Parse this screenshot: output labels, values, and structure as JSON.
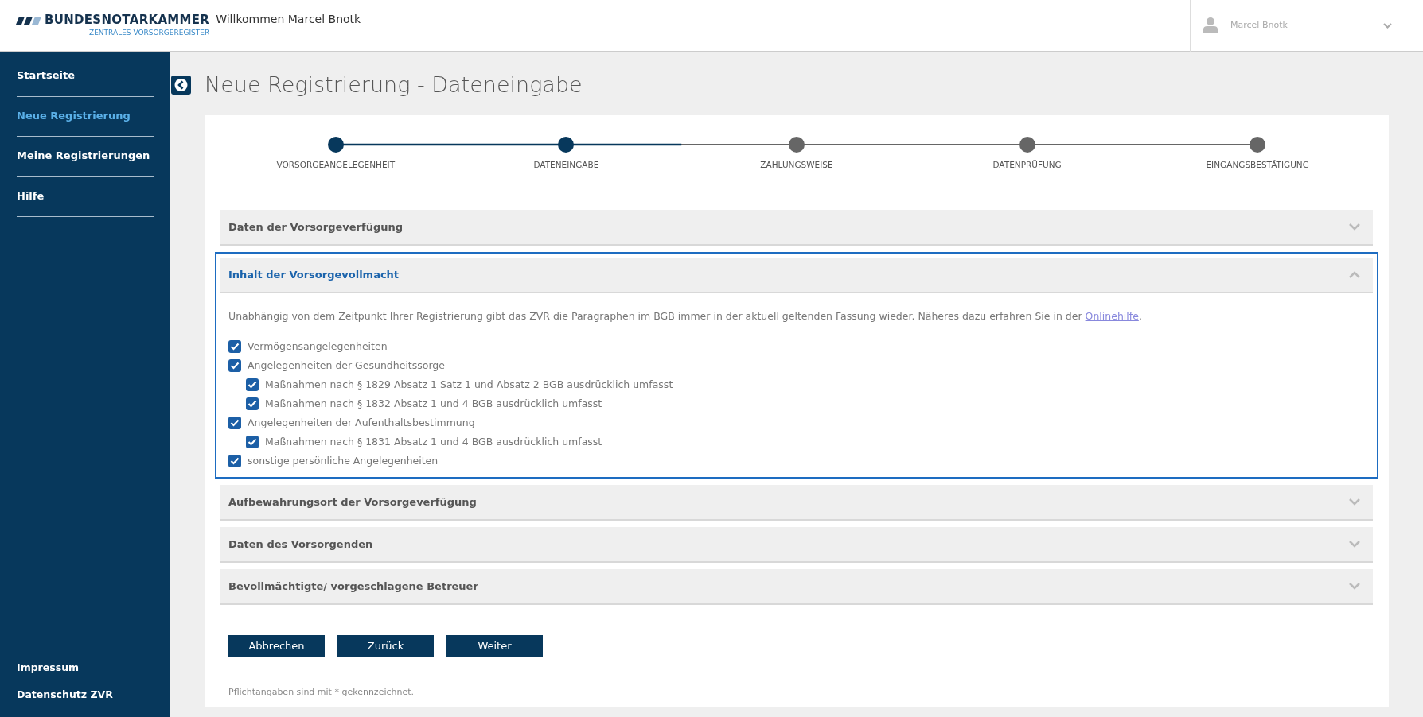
{
  "header": {
    "logo_title": "BUNDESNOTARKAMMER",
    "logo_subtitle": "ZENTRALES VORSORGEREGISTER",
    "welcome": "Willkommen Marcel Bnotk",
    "user_name": "Marcel Bnotk"
  },
  "sidebar": {
    "items": [
      {
        "label": "Startseite",
        "selected": false
      },
      {
        "label": "Neue Registrierung",
        "selected": true
      },
      {
        "label": "Meine Registrierungen",
        "selected": false
      },
      {
        "label": "Hilfe",
        "selected": false
      }
    ],
    "footer_links": [
      "Impressum",
      "Datenschutz ZVR"
    ]
  },
  "page_title": "Neue Registrierung - Dateneingabe",
  "steps": [
    {
      "label": "VORSORGEANGELEGENHEIT",
      "completed": true
    },
    {
      "label": "DATENEINGABE",
      "completed": true
    },
    {
      "label": "ZAHLUNGSWEISE",
      "completed": false
    },
    {
      "label": "DATENPRÜFUNG",
      "completed": false
    },
    {
      "label": "EINGANGSBESTÄTIGUNG",
      "completed": false
    }
  ],
  "sections": [
    {
      "title": "Daten der Vorsorgeverfügung",
      "expanded": false
    },
    {
      "title": "Inhalt der Vorsorgevollmacht",
      "expanded": true,
      "intro": {
        "text": "Unabhängig von dem Zeitpunkt Ihrer Registrierung gibt das ZVR die Paragraphen im BGB immer in der aktuell geltenden Fassung wieder. Näheres dazu erfahren Sie in der ",
        "link": "Onlinehilfe",
        "end": "."
      },
      "options": [
        {
          "label": "Vermögensangelegenheiten",
          "checked": true
        },
        {
          "label": "Angelegenheiten der Gesundheitssorge",
          "checked": true,
          "children": [
            {
              "label": "Maßnahmen nach § 1829 Absatz 1 Satz 1 und Absatz 2 BGB ausdrücklich umfasst",
              "checked": true
            },
            {
              "label": "Maßnahmen nach § 1832 Absatz 1 und 4 BGB ausdrücklich umfasst",
              "checked": true
            }
          ]
        },
        {
          "label": "Angelegenheiten der Aufenthaltsbestimmung",
          "checked": true,
          "children": [
            {
              "label": "Maßnahmen nach § 1831 Absatz 1 und 4 BGB ausdrücklich umfasst",
              "checked": true
            }
          ]
        },
        {
          "label": "sonstige persönliche Angelegenheiten",
          "checked": true
        }
      ]
    },
    {
      "title": "Aufbewahrungsort der Vorsorgeverfügung",
      "expanded": false
    },
    {
      "title": "Daten des Vorsorgenden",
      "expanded": false
    },
    {
      "title": "Bevollmächtigte/ vorgeschlagene Betreuer",
      "expanded": false
    }
  ],
  "buttons": [
    "Abbrechen",
    "Zurück",
    "Weiter"
  ],
  "footnote": "Pflichtangaben sind mit * gekennzeichnet."
}
